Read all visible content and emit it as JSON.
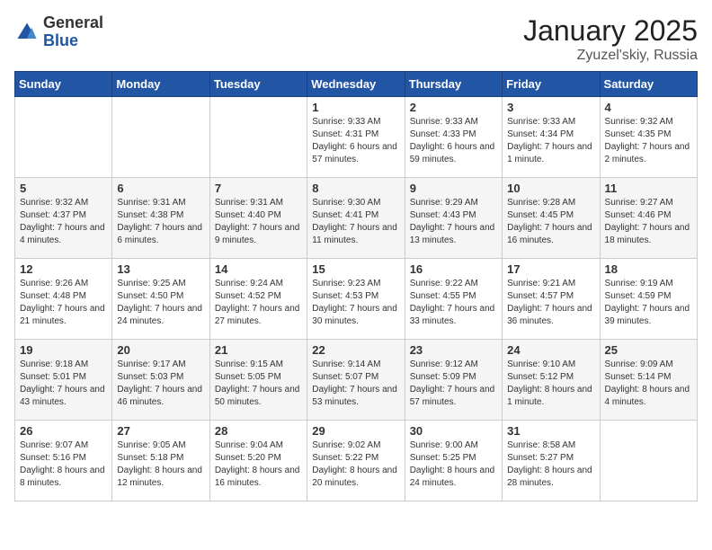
{
  "logo": {
    "general": "General",
    "blue": "Blue"
  },
  "title": "January 2025",
  "subtitle": "Zyuzel'skiy, Russia",
  "days_header": [
    "Sunday",
    "Monday",
    "Tuesday",
    "Wednesday",
    "Thursday",
    "Friday",
    "Saturday"
  ],
  "weeks": [
    [
      {
        "day": "",
        "content": ""
      },
      {
        "day": "",
        "content": ""
      },
      {
        "day": "",
        "content": ""
      },
      {
        "day": "1",
        "content": "Sunrise: 9:33 AM\nSunset: 4:31 PM\nDaylight: 6 hours and 57 minutes."
      },
      {
        "day": "2",
        "content": "Sunrise: 9:33 AM\nSunset: 4:33 PM\nDaylight: 6 hours and 59 minutes."
      },
      {
        "day": "3",
        "content": "Sunrise: 9:33 AM\nSunset: 4:34 PM\nDaylight: 7 hours and 1 minute."
      },
      {
        "day": "4",
        "content": "Sunrise: 9:32 AM\nSunset: 4:35 PM\nDaylight: 7 hours and 2 minutes."
      }
    ],
    [
      {
        "day": "5",
        "content": "Sunrise: 9:32 AM\nSunset: 4:37 PM\nDaylight: 7 hours and 4 minutes."
      },
      {
        "day": "6",
        "content": "Sunrise: 9:31 AM\nSunset: 4:38 PM\nDaylight: 7 hours and 6 minutes."
      },
      {
        "day": "7",
        "content": "Sunrise: 9:31 AM\nSunset: 4:40 PM\nDaylight: 7 hours and 9 minutes."
      },
      {
        "day": "8",
        "content": "Sunrise: 9:30 AM\nSunset: 4:41 PM\nDaylight: 7 hours and 11 minutes."
      },
      {
        "day": "9",
        "content": "Sunrise: 9:29 AM\nSunset: 4:43 PM\nDaylight: 7 hours and 13 minutes."
      },
      {
        "day": "10",
        "content": "Sunrise: 9:28 AM\nSunset: 4:45 PM\nDaylight: 7 hours and 16 minutes."
      },
      {
        "day": "11",
        "content": "Sunrise: 9:27 AM\nSunset: 4:46 PM\nDaylight: 7 hours and 18 minutes."
      }
    ],
    [
      {
        "day": "12",
        "content": "Sunrise: 9:26 AM\nSunset: 4:48 PM\nDaylight: 7 hours and 21 minutes."
      },
      {
        "day": "13",
        "content": "Sunrise: 9:25 AM\nSunset: 4:50 PM\nDaylight: 7 hours and 24 minutes."
      },
      {
        "day": "14",
        "content": "Sunrise: 9:24 AM\nSunset: 4:52 PM\nDaylight: 7 hours and 27 minutes."
      },
      {
        "day": "15",
        "content": "Sunrise: 9:23 AM\nSunset: 4:53 PM\nDaylight: 7 hours and 30 minutes."
      },
      {
        "day": "16",
        "content": "Sunrise: 9:22 AM\nSunset: 4:55 PM\nDaylight: 7 hours and 33 minutes."
      },
      {
        "day": "17",
        "content": "Sunrise: 9:21 AM\nSunset: 4:57 PM\nDaylight: 7 hours and 36 minutes."
      },
      {
        "day": "18",
        "content": "Sunrise: 9:19 AM\nSunset: 4:59 PM\nDaylight: 7 hours and 39 minutes."
      }
    ],
    [
      {
        "day": "19",
        "content": "Sunrise: 9:18 AM\nSunset: 5:01 PM\nDaylight: 7 hours and 43 minutes."
      },
      {
        "day": "20",
        "content": "Sunrise: 9:17 AM\nSunset: 5:03 PM\nDaylight: 7 hours and 46 minutes."
      },
      {
        "day": "21",
        "content": "Sunrise: 9:15 AM\nSunset: 5:05 PM\nDaylight: 7 hours and 50 minutes."
      },
      {
        "day": "22",
        "content": "Sunrise: 9:14 AM\nSunset: 5:07 PM\nDaylight: 7 hours and 53 minutes."
      },
      {
        "day": "23",
        "content": "Sunrise: 9:12 AM\nSunset: 5:09 PM\nDaylight: 7 hours and 57 minutes."
      },
      {
        "day": "24",
        "content": "Sunrise: 9:10 AM\nSunset: 5:12 PM\nDaylight: 8 hours and 1 minute."
      },
      {
        "day": "25",
        "content": "Sunrise: 9:09 AM\nSunset: 5:14 PM\nDaylight: 8 hours and 4 minutes."
      }
    ],
    [
      {
        "day": "26",
        "content": "Sunrise: 9:07 AM\nSunset: 5:16 PM\nDaylight: 8 hours and 8 minutes."
      },
      {
        "day": "27",
        "content": "Sunrise: 9:05 AM\nSunset: 5:18 PM\nDaylight: 8 hours and 12 minutes."
      },
      {
        "day": "28",
        "content": "Sunrise: 9:04 AM\nSunset: 5:20 PM\nDaylight: 8 hours and 16 minutes."
      },
      {
        "day": "29",
        "content": "Sunrise: 9:02 AM\nSunset: 5:22 PM\nDaylight: 8 hours and 20 minutes."
      },
      {
        "day": "30",
        "content": "Sunrise: 9:00 AM\nSunset: 5:25 PM\nDaylight: 8 hours and 24 minutes."
      },
      {
        "day": "31",
        "content": "Sunrise: 8:58 AM\nSunset: 5:27 PM\nDaylight: 8 hours and 28 minutes."
      },
      {
        "day": "",
        "content": ""
      }
    ]
  ]
}
